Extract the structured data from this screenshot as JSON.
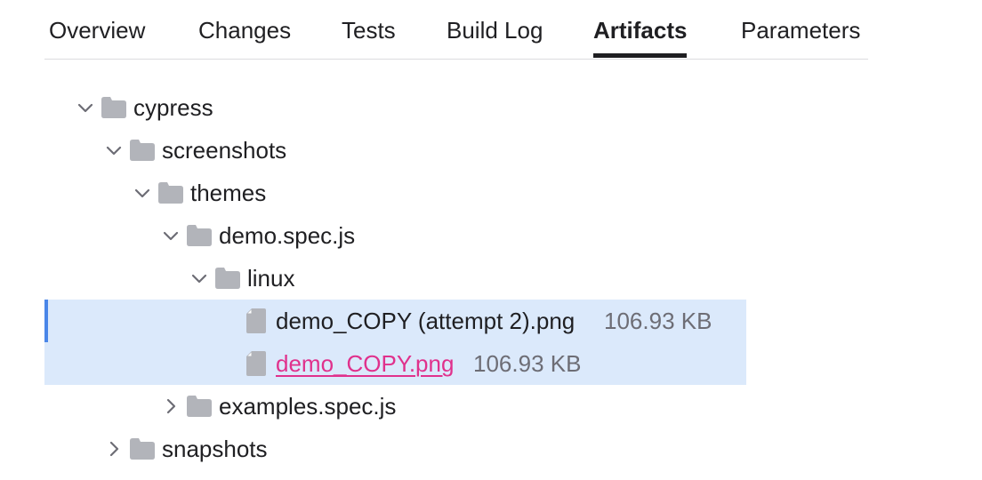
{
  "tabs": [
    {
      "label": "Overview",
      "active": false
    },
    {
      "label": "Changes",
      "active": false
    },
    {
      "label": "Tests",
      "active": false
    },
    {
      "label": "Build Log",
      "active": false
    },
    {
      "label": "Artifacts",
      "active": true
    },
    {
      "label": "Parameters",
      "active": false
    }
  ],
  "tree": [
    {
      "type": "folder",
      "name": "cypress",
      "expanded": true,
      "icon": "folder-icon",
      "chevron": "chevron-down-icon"
    },
    {
      "type": "folder",
      "name": "screenshots",
      "expanded": true,
      "icon": "folder-icon",
      "chevron": "chevron-down-icon"
    },
    {
      "type": "folder",
      "name": "themes",
      "expanded": true,
      "icon": "folder-icon",
      "chevron": "chevron-down-icon"
    },
    {
      "type": "folder",
      "name": "demo.spec.js",
      "expanded": true,
      "icon": "folder-icon",
      "chevron": "chevron-down-icon"
    },
    {
      "type": "folder",
      "name": "linux",
      "expanded": true,
      "icon": "folder-icon",
      "chevron": "chevron-down-icon"
    },
    {
      "type": "file",
      "name": "demo_COPY (attempt 2).png",
      "size": "106.93 KB",
      "selected": true,
      "focused": true,
      "icon": "file-icon"
    },
    {
      "type": "file",
      "name": "demo_COPY.png",
      "size": "106.93 KB",
      "selected": true,
      "hovered": true,
      "icon": "file-icon"
    },
    {
      "type": "folder",
      "name": "examples.spec.js",
      "expanded": false,
      "icon": "folder-icon",
      "chevron": "chevron-right-icon"
    },
    {
      "type": "folder",
      "name": "snapshots",
      "expanded": false,
      "icon": "folder-icon",
      "chevron": "chevron-right-icon"
    }
  ],
  "colors": {
    "selection": "#dbe9fb",
    "focus_bar": "#4a86e8",
    "link": "#e0318c",
    "icon": "#b2b4ba",
    "muted_text": "#6d6d75"
  }
}
